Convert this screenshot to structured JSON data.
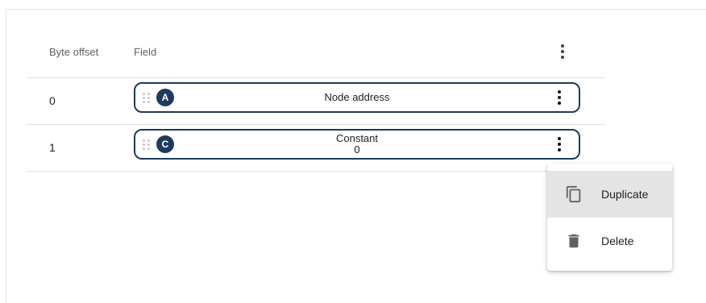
{
  "table": {
    "headers": {
      "byte_offset": "Byte offset",
      "field": "Field"
    },
    "rows": [
      {
        "offset": "0",
        "badge": "A",
        "label_line1": "Node address",
        "label_line2": ""
      },
      {
        "offset": "1",
        "badge": "C",
        "label_line1": "Constant",
        "label_line2": "0"
      }
    ]
  },
  "context_menu": {
    "items": [
      {
        "label": "Duplicate",
        "icon": "copy-icon",
        "highlighted": true
      },
      {
        "label": "Delete",
        "icon": "trash-icon",
        "highlighted": false
      }
    ]
  },
  "colors": {
    "accent": "#1e3a5f",
    "highlight": "#e4e4e4",
    "divider": "#e0e0e0"
  }
}
